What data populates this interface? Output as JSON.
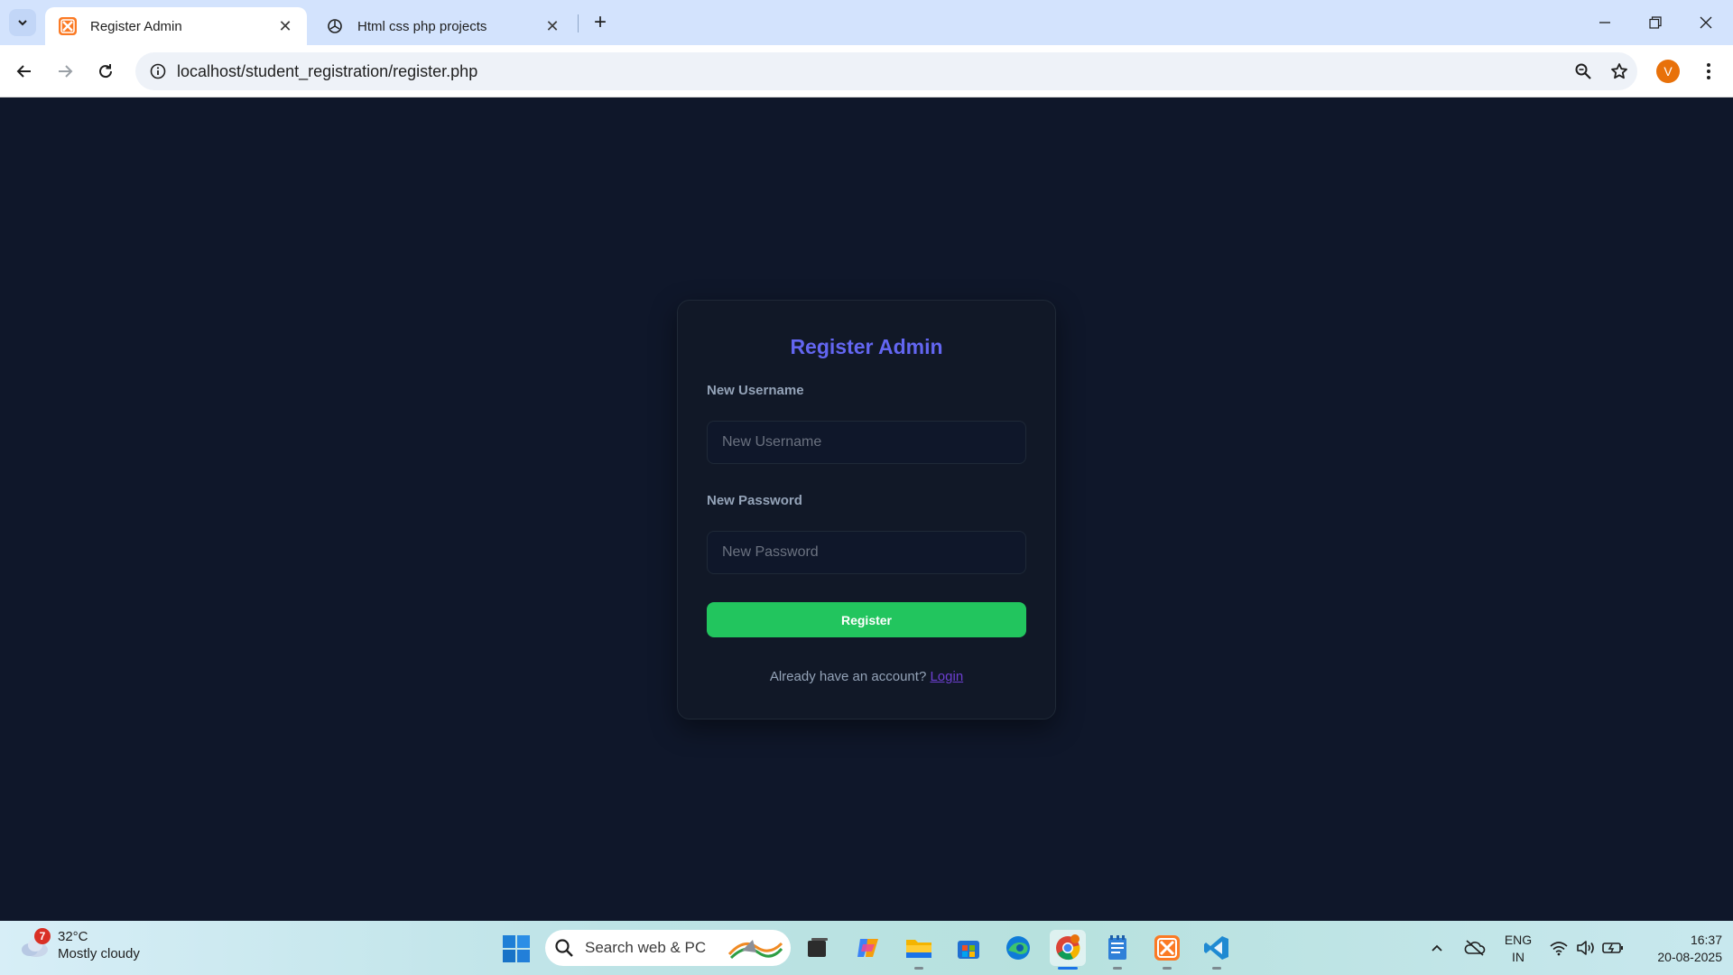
{
  "browser": {
    "tabs": [
      {
        "title": "Register Admin",
        "active": true,
        "favicon": "xampp-icon"
      },
      {
        "title": "Html css php projects",
        "active": false,
        "favicon": "openai-icon"
      }
    ],
    "url": "localhost/student_registration/register.php",
    "profile_initial": "V"
  },
  "form": {
    "heading": "Register Admin",
    "username_label": "New Username",
    "username_placeholder": "New Username",
    "password_label": "New Password",
    "password_placeholder": "New Password",
    "submit_label": "Register",
    "footer_text": "Already have an account?",
    "login_link": "Login"
  },
  "taskbar": {
    "weather": {
      "badge": "7",
      "temperature": "32°C",
      "condition": "Mostly cloudy"
    },
    "search_placeholder": "Search web & PC",
    "language": {
      "line1": "ENG",
      "line2": "IN"
    },
    "time": "16:37",
    "date": "20-08-2025"
  },
  "colors": {
    "page_bg": "#0f172a",
    "card_bg": "#111827",
    "heading": "#6366f1",
    "button": "#22c55e",
    "link": "#6d3fd1"
  }
}
